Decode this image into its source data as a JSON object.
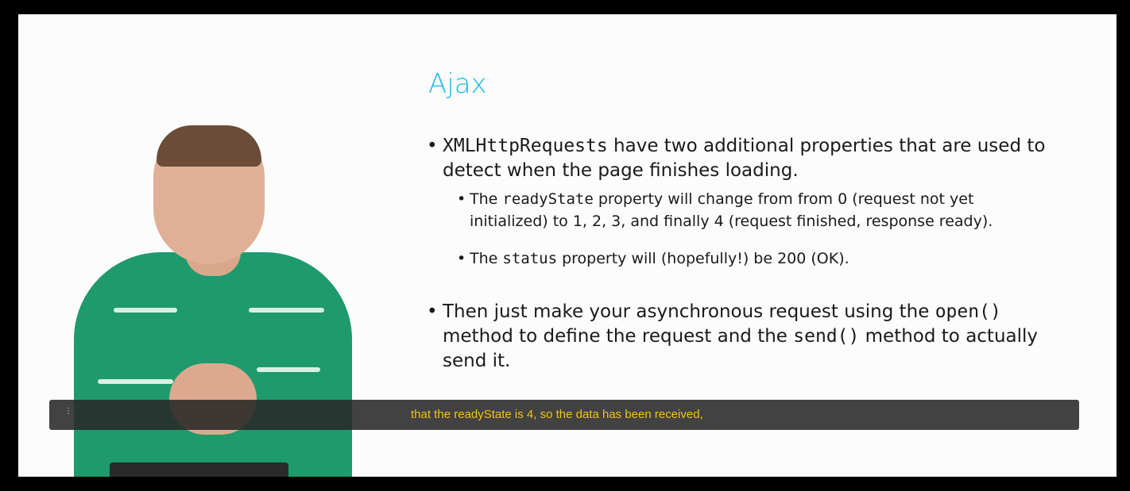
{
  "slide": {
    "title": "Ajax",
    "bullets": [
      {
        "code": "XMLHttpRequests",
        "text": " have two additional properties that are used to detect when the page finishes loading.",
        "sub": [
          {
            "prefix": "The ",
            "code": "readyState",
            "text": " property will change from from 0 (request not yet initialized) to 1, 2, 3, and finally 4 (request finished, response ready)."
          },
          {
            "prefix": "The ",
            "code": "status",
            "text": " property will (hopefully!) be 200 (OK)."
          }
        ]
      },
      {
        "prefix": "Then just make your asynchronous request using the ",
        "code1": "open()",
        "mid": " method to define the request and the ",
        "code2": "send()",
        "text": " method to actually send it."
      }
    ]
  },
  "caption": {
    "text": "that the readyState is 4, so the data has been received,",
    "color": "#f2c318",
    "handle_icon": "drag-handle-icon"
  },
  "colors": {
    "title": "#1fbce6",
    "shirt": "#1e9a6d"
  }
}
